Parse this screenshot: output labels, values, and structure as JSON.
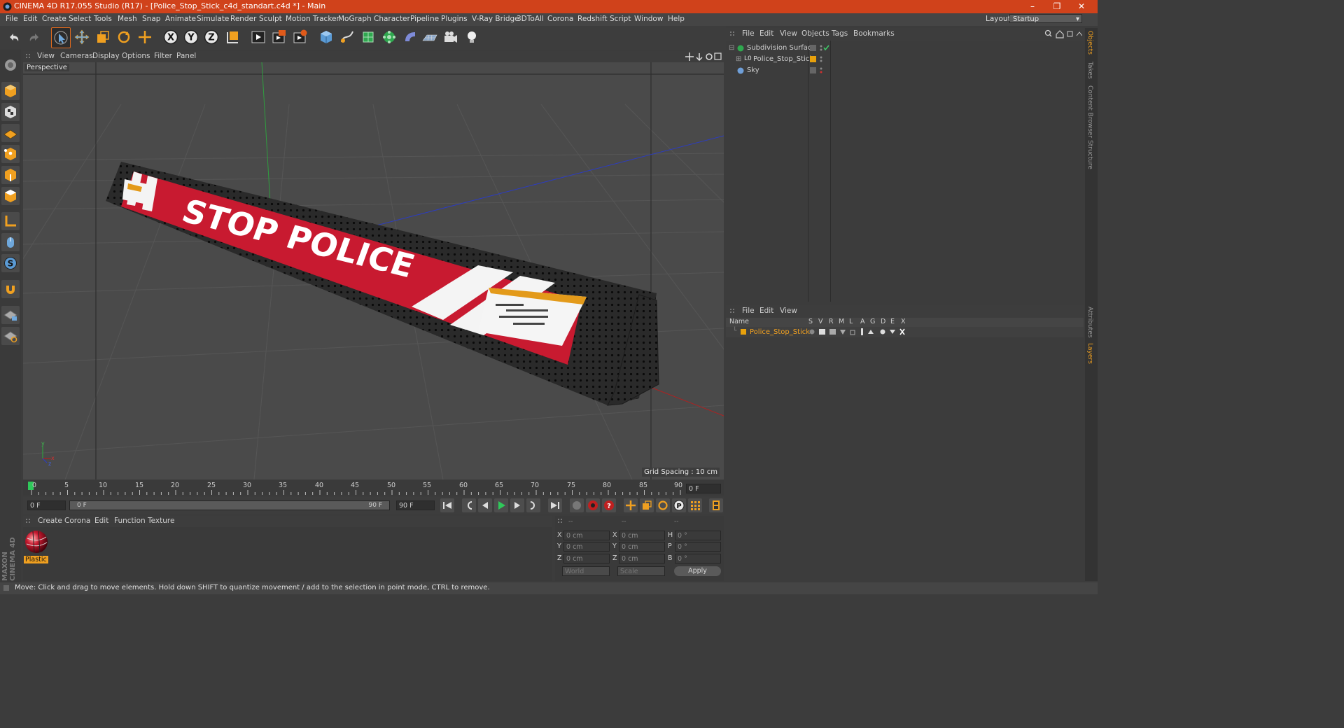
{
  "window": {
    "title": "CINEMA 4D R17.055 Studio (R17) - [Police_Stop_Stick_c4d_standart.c4d *] - Main",
    "minimize": "–",
    "restore": "❐",
    "close": "✕"
  },
  "menubar": {
    "items": [
      "File",
      "Edit",
      "Create",
      "Select",
      "Tools",
      "Mesh",
      "Snap",
      "Animate",
      "Simulate",
      "Render",
      "Sculpt",
      "Motion Tracker",
      "MoGraph",
      "Character",
      "Pipeline",
      "Plugins",
      "V-Ray Bridge",
      "3DToAll",
      "Corona",
      "Redshift",
      "Script",
      "Window",
      "Help"
    ],
    "layout_label": "Layout:",
    "layout_value": "Startup"
  },
  "viewport": {
    "menu": [
      "View",
      "Cameras",
      "Display",
      "Options",
      "Filter",
      "Panel"
    ],
    "label": "Perspective",
    "grid_spacing": "Grid Spacing : 10 cm",
    "model_text": "STOP POLICE"
  },
  "timeline": {
    "ticks": [
      "0",
      "5",
      "10",
      "15",
      "20",
      "25",
      "30",
      "35",
      "40",
      "45",
      "50",
      "55",
      "60",
      "65",
      "70",
      "75",
      "80",
      "85",
      "90"
    ],
    "current_frame": "0 F",
    "start_field": "0 F",
    "range_start": "0 F",
    "range_end": "90 F",
    "end_field": "90 F"
  },
  "material_manager": {
    "menu": [
      "Create",
      "Corona",
      "Edit",
      "Function",
      "Texture"
    ],
    "material_name": "Plastic"
  },
  "coordinates": {
    "headers": [
      "--",
      "--",
      "--"
    ],
    "rows": [
      {
        "axis": "X",
        "pos": "0 cm",
        "axis2": "X",
        "size": "0 cm",
        "rot_label": "H",
        "rot": "0 °"
      },
      {
        "axis": "Y",
        "pos": "0 cm",
        "axis2": "Y",
        "size": "0 cm",
        "rot_label": "P",
        "rot": "0 °"
      },
      {
        "axis": "Z",
        "pos": "0 cm",
        "axis2": "Z",
        "size": "0 cm",
        "rot_label": "B",
        "rot": "0 °"
      }
    ],
    "mode1": "World",
    "mode2": "Scale",
    "apply": "Apply"
  },
  "object_manager": {
    "menu": [
      "File",
      "Edit",
      "View",
      "Objects",
      "Tags",
      "Bookmarks"
    ],
    "objects": [
      {
        "name": "Subdivision Surface",
        "color": "#2fa84f"
      },
      {
        "name": "Police_Stop_Stick",
        "color": "#e8a10c"
      },
      {
        "name": "Sky",
        "color": "#6f9fd8"
      }
    ]
  },
  "layer_manager": {
    "menu": [
      "File",
      "Edit",
      "View"
    ],
    "columns": [
      "Name",
      "S",
      "V",
      "R",
      "M",
      "L",
      "A",
      "G",
      "D",
      "E",
      "X"
    ],
    "layers": [
      {
        "name": "Police_Stop_Stick",
        "color": "#e8a10c"
      }
    ]
  },
  "side_tabs": [
    "Objects",
    "Takes",
    "Content Browser",
    "Structure",
    "Attributes",
    "Layers"
  ],
  "branding": "MAXON CINEMA 4D",
  "status": "Move: Click and drag to move elements. Hold down SHIFT to quantize movement / add to the selection in point mode, CTRL to remove.",
  "icons": [
    "undo-icon",
    "redo-icon",
    "live-selection-icon",
    "move-icon",
    "scale-icon",
    "rotate-icon",
    "x-axis-icon",
    "y-axis-icon",
    "z-axis-icon",
    "render-icon",
    "cube-icon",
    "spline-icon",
    "camera-icon",
    "light-icon"
  ]
}
